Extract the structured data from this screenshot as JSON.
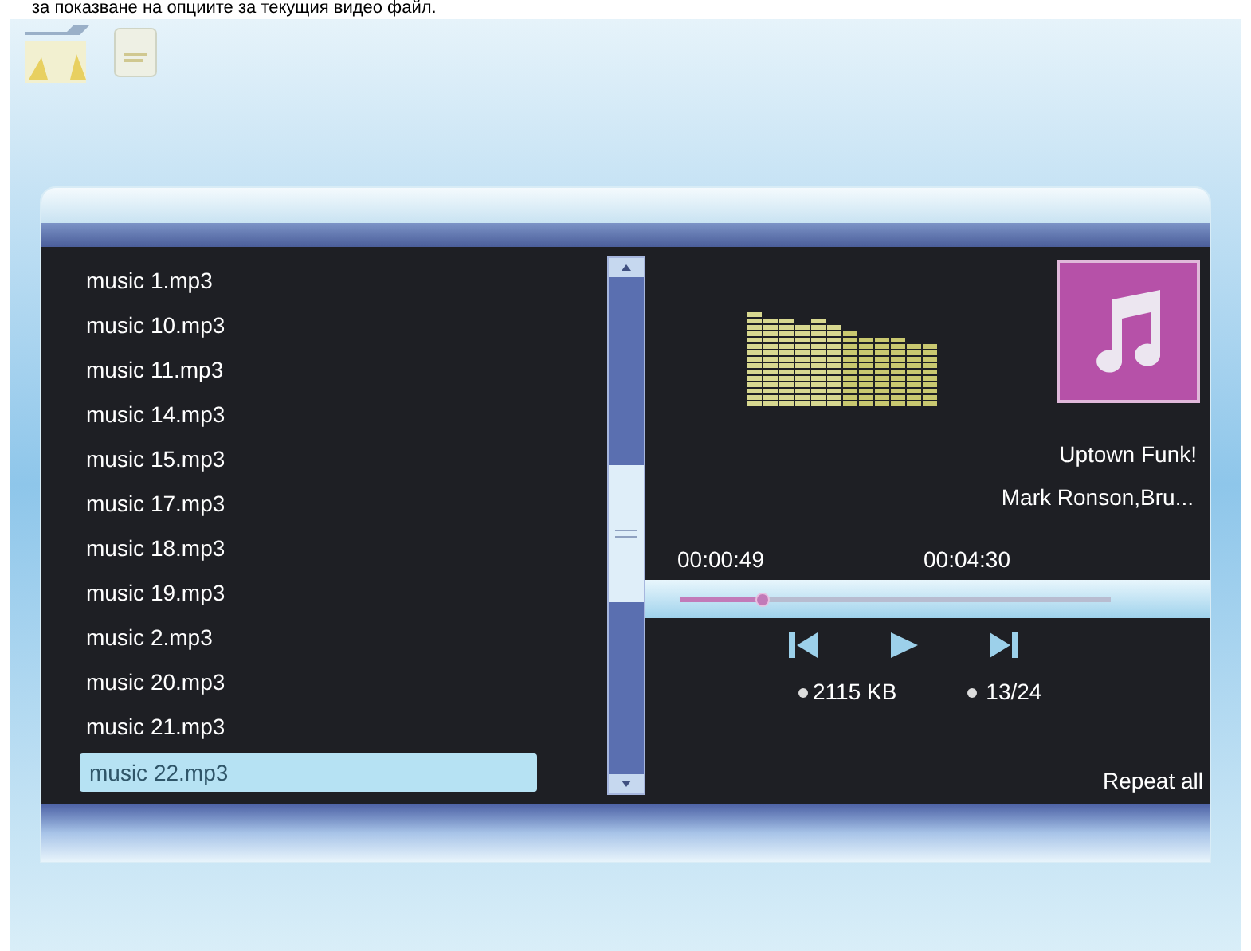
{
  "caption": "за показване на опциите за текущия видео файл.",
  "playlist": [
    {
      "name": "music 1.mp3",
      "selected": false
    },
    {
      "name": "music 10.mp3",
      "selected": false
    },
    {
      "name": "music 11.mp3",
      "selected": false
    },
    {
      "name": "music 14.mp3",
      "selected": false
    },
    {
      "name": "music 15.mp3",
      "selected": false
    },
    {
      "name": "music 17.mp3",
      "selected": false
    },
    {
      "name": "music 18.mp3",
      "selected": false
    },
    {
      "name": "music 19.mp3",
      "selected": false
    },
    {
      "name": "music 2.mp3",
      "selected": false
    },
    {
      "name": "music 20.mp3",
      "selected": false
    },
    {
      "name": "music 21.mp3",
      "selected": false
    },
    {
      "name": "music 22.mp3",
      "selected": true
    }
  ],
  "track": {
    "title": "Uptown Funk!",
    "artist": "Mark Ronson,Bru..."
  },
  "progress": {
    "elapsed": "00:00:49",
    "total": "00:04:30",
    "level": 0.19
  },
  "info": {
    "size": "2115 KB",
    "position": "13/24"
  },
  "repeat_mode": "Repeat all"
}
